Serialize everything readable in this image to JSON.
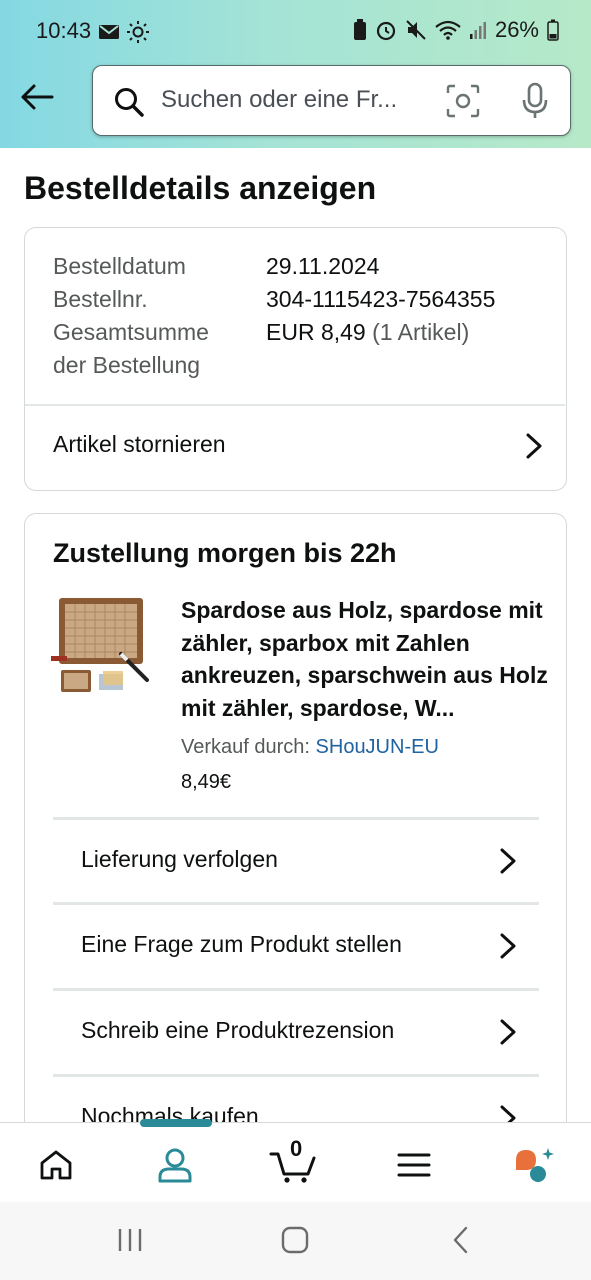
{
  "status_bar": {
    "time": "10:43",
    "battery": "26%"
  },
  "search": {
    "placeholder": "Suchen oder eine Fr..."
  },
  "page": {
    "title": "Bestelldetails anzeigen"
  },
  "order_summary": {
    "date_label": "Bestelldatum",
    "date_value": "29.11.2024",
    "number_label": "Bestellnr.",
    "number_value": "304-1115423-7564355",
    "total_label_line1": "Gesamtsumme",
    "total_label_line2": "der Bestellung",
    "total_value": "EUR 8,49",
    "total_items": "(1 Artikel)",
    "cancel_label": "Artikel stornieren"
  },
  "delivery": {
    "title": "Zustellung morgen bis 22h",
    "product_title": "Spardose aus Holz, spardose mit zähler, sparbox mit Zahlen ankreuzen, sparschwein aus Holz mit zähler, spardose, W...",
    "seller_prefix": "Verkauf durch:",
    "seller_name": "SHouJUN-EU",
    "price": "8,49€",
    "actions": [
      {
        "label": "Lieferung verfolgen"
      },
      {
        "label": "Eine Frage zum Produkt stellen"
      },
      {
        "label": "Schreib eine Produktrezension"
      },
      {
        "label": "Nochmals kaufen"
      }
    ]
  },
  "bottom_nav": {
    "items": [
      {
        "icon": "home-icon"
      },
      {
        "icon": "account-icon",
        "active": true
      },
      {
        "icon": "cart-icon"
      },
      {
        "icon": "menu-icon"
      },
      {
        "icon": "rufus-ai-icon"
      }
    ],
    "cart_count": "0"
  },
  "colors": {
    "accent": "#2a8a98",
    "link": "#2162a1",
    "header_gradient_start": "#84d8e3",
    "header_gradient_end": "#b6e9c8"
  }
}
